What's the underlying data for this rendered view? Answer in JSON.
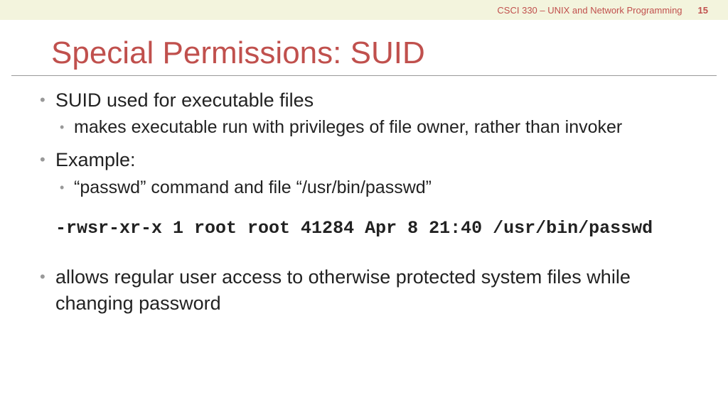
{
  "header": {
    "course": "CSCI 330 – UNIX and Network Programming",
    "page": "15"
  },
  "title": "Special Permissions: SUID",
  "bullets": {
    "b1": "SUID used for executable files",
    "b1_1": "makes executable run with privileges of file owner, rather than invoker",
    "b2": "Example:",
    "b2_1": "“passwd” command  and file “/usr/bin/passwd”",
    "b3": "allows regular user access to otherwise protected system files while changing password"
  },
  "code": "-rwsr-xr-x 1 root root 41284 Apr 8 21:40 /usr/bin/passwd"
}
